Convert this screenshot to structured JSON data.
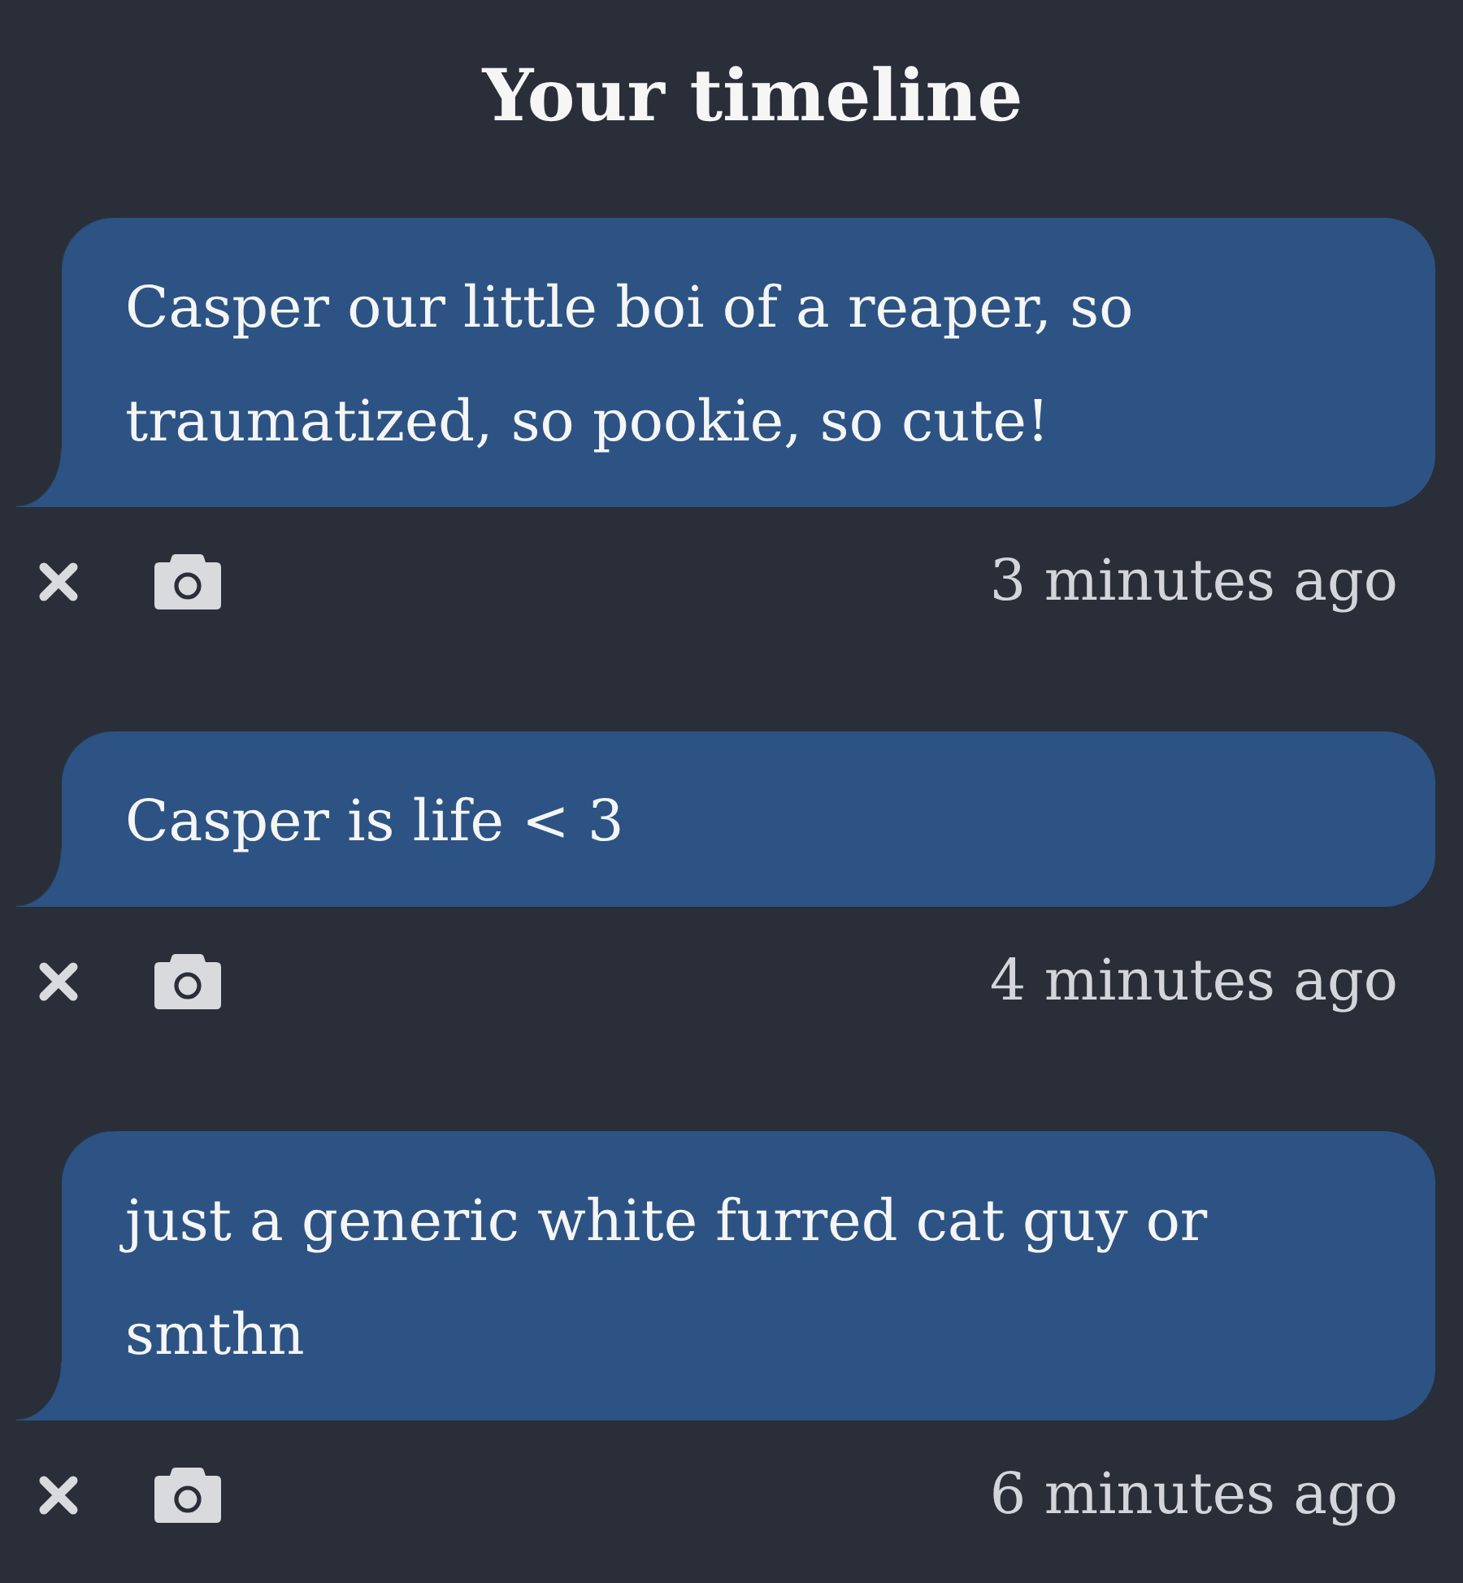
{
  "title": "Your timeline",
  "posts": [
    {
      "text": "Casper our little boi of a reaper, so traumatized, so pookie, so cute!",
      "time": "3 minutes ago"
    },
    {
      "text": "Casper is life < 3",
      "time": "4 minutes ago"
    },
    {
      "text": "just a generic white furred cat guy or smthn",
      "time": "6 minutes ago"
    }
  ]
}
